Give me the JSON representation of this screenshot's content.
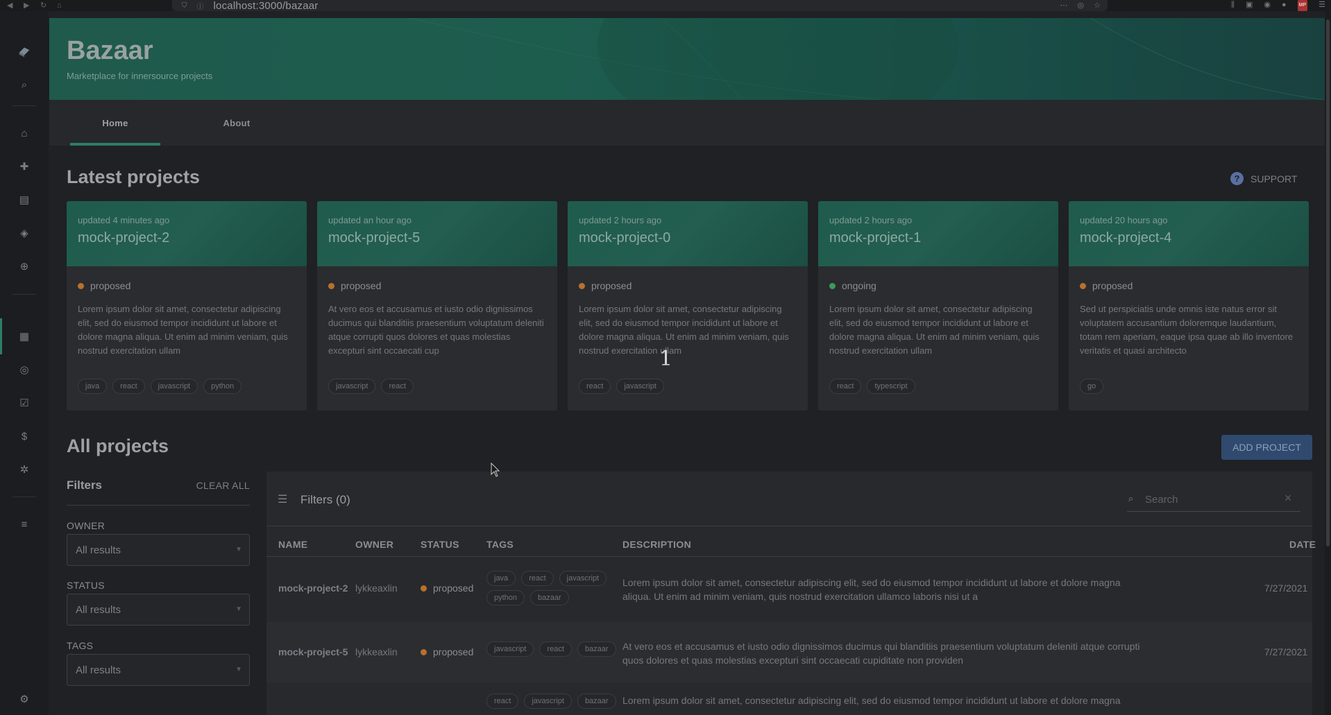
{
  "browser": {
    "url": "localhost:3000/bazaar",
    "mp_badge": "MP"
  },
  "app": {
    "title": "Bazaar",
    "subtitle": "Marketplace for innersource projects"
  },
  "tabs": [
    {
      "label": "Home",
      "active": true
    },
    {
      "label": "About",
      "active": false
    }
  ],
  "latest": {
    "title": "Latest projects",
    "support_label": "SUPPORT",
    "cards": [
      {
        "updated": "updated 4 minutes ago",
        "name": "mock-project-2",
        "status": "proposed",
        "status_color": "#b8702e",
        "description": "Lorem ipsum dolor sit amet, consectetur adipiscing elit, sed do eiusmod tempor incididunt ut labore et dolore magna aliqua. Ut enim ad minim veniam, quis nostrud exercitation ullam",
        "tags": [
          "java",
          "react",
          "javascript",
          "python"
        ]
      },
      {
        "updated": "updated an hour ago",
        "name": "mock-project-5",
        "status": "proposed",
        "status_color": "#b8702e",
        "description": "At vero eos et accusamus et iusto odio dignissimos ducimus qui blanditiis praesentium voluptatum deleniti atque corrupti quos dolores et quas molestias excepturi sint occaecati cup",
        "tags": [
          "javascript",
          "react"
        ]
      },
      {
        "updated": "updated 2 hours ago",
        "name": "mock-project-0",
        "status": "proposed",
        "status_color": "#b8702e",
        "description": "Lorem ipsum dolor sit amet, consectetur adipiscing elit, sed do eiusmod tempor incididunt ut labore et dolore magna aliqua. Ut enim ad minim veniam, quis nostrud exercitation ullam",
        "tags": [
          "react",
          "javascript"
        ]
      },
      {
        "updated": "updated 2 hours ago",
        "name": "mock-project-1",
        "status": "ongoing",
        "status_color": "#3f9a55",
        "description": "Lorem ipsum dolor sit amet, consectetur adipiscing elit, sed do eiusmod tempor incididunt ut labore et dolore magna aliqua. Ut enim ad minim veniam, quis nostrud exercitation ullam",
        "tags": [
          "react",
          "typescript"
        ]
      },
      {
        "updated": "updated 20 hours ago",
        "name": "mock-project-4",
        "status": "proposed",
        "status_color": "#b8702e",
        "description": "Sed ut perspiciatis unde omnis iste natus error sit voluptatem accusantium doloremque laudantium, totam rem aperiam, eaque ipsa quae ab illo inventore veritatis et quasi architecto",
        "tags": [
          "go"
        ]
      }
    ]
  },
  "all": {
    "title": "All projects",
    "add_button": "ADD PROJECT",
    "filters": {
      "title": "Filters",
      "clear_all": "CLEAR ALL",
      "owner_label": "OWNER",
      "owner_value": "All results",
      "status_label": "STATUS",
      "status_value": "All results",
      "tags_label": "TAGS",
      "tags_value": "All results"
    },
    "table": {
      "filters_title": "Filters (0)",
      "search_placeholder": "Search",
      "columns": [
        "NAME",
        "OWNER",
        "STATUS",
        "TAGS",
        "DESCRIPTION",
        "DATE"
      ],
      "rows": [
        {
          "name": "mock-project-2",
          "owner": "lykkeaxlin",
          "status": "proposed",
          "tags": [
            "java",
            "react",
            "javascript",
            "python",
            "bazaar"
          ],
          "description": "Lorem ipsum dolor sit amet, consectetur adipiscing elit, sed do eiusmod tempor incididunt ut labore et dolore magna aliqua. Ut enim ad minim veniam, quis nostrud exercitation ullamco laboris nisi ut a",
          "date": "7/27/2021"
        },
        {
          "name": "mock-project-5",
          "owner": "lykkeaxlin",
          "status": "proposed",
          "tags": [
            "javascript",
            "react",
            "bazaar"
          ],
          "description": "At vero eos et accusamus et iusto odio dignissimos ducimus qui blanditiis praesentium voluptatum deleniti atque corrupti quos dolores et quas molestias excepturi sint occaecati cupiditate non providen",
          "date": "7/27/2021"
        },
        {
          "name": "",
          "owner": "",
          "status": "",
          "tags": [
            "react",
            "javascript",
            "bazaar"
          ],
          "description": "Lorem ipsum dolor sit amet, consectetur adipiscing elit, sed do eiusmod tempor incididunt ut labore et dolore magna",
          "date": ""
        }
      ]
    }
  },
  "overlay": {
    "number": "1"
  },
  "colors": {
    "accent": "#2e7d6a",
    "proposed": "#b8702e",
    "ongoing": "#3f9a55",
    "button": "#2f4a6e"
  }
}
